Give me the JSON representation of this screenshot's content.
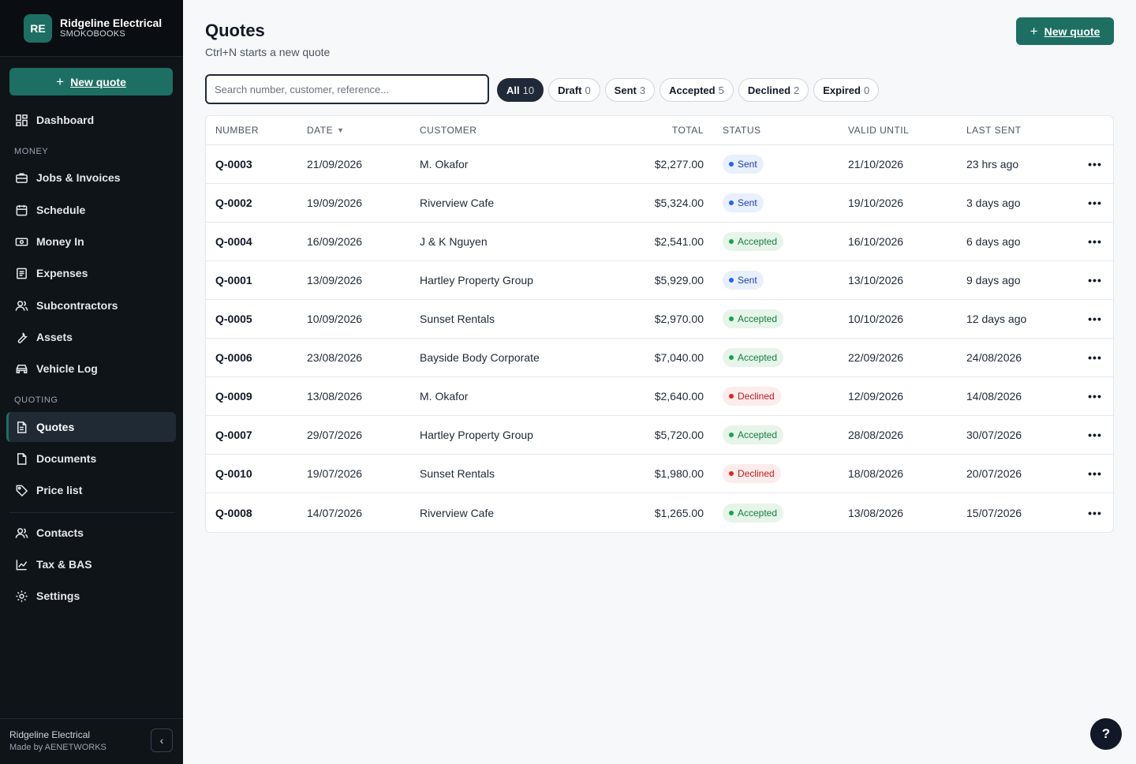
{
  "brand": {
    "initials": "RE",
    "name": "Ridgeline Electrical",
    "sub": "SMOKOBOOKS"
  },
  "sidebar": {
    "new_quote": "New quote",
    "dashboard": "Dashboard",
    "section_money": "MONEY",
    "section_quoting": "QUOTING",
    "items": {
      "jobs": "Jobs & Invoices",
      "schedule": "Schedule",
      "money_in": "Money In",
      "expenses": "Expenses",
      "subcontractors": "Subcontractors",
      "assets": "Assets",
      "vehicle_log": "Vehicle Log",
      "quotes": "Quotes",
      "documents": "Documents",
      "price_list": "Price list",
      "contacts": "Contacts",
      "tax": "Tax & BAS",
      "settings": "Settings"
    },
    "footer_name": "Ridgeline Electrical",
    "footer_made": "Made by AENETWORKS"
  },
  "header": {
    "title": "Quotes",
    "subtitle": "Ctrl+N starts a new quote",
    "new_quote": "New quote"
  },
  "search": {
    "placeholder": "Search number, customer, reference..."
  },
  "filters": [
    {
      "label": "All",
      "count": "10",
      "active": true
    },
    {
      "label": "Draft",
      "count": "0"
    },
    {
      "label": "Sent",
      "count": "3"
    },
    {
      "label": "Accepted",
      "count": "5"
    },
    {
      "label": "Declined",
      "count": "2"
    },
    {
      "label": "Expired",
      "count": "0"
    }
  ],
  "table": {
    "columns": {
      "number": "NUMBER",
      "date": "DATE",
      "customer": "CUSTOMER",
      "total": "TOTAL",
      "status": "STATUS",
      "valid_until": "VALID UNTIL",
      "last_sent": "LAST SENT"
    },
    "rows": [
      {
        "number": "Q-0003",
        "date": "21/09/2026",
        "customer": "M. Okafor",
        "total": "$2,277.00",
        "status": "Sent",
        "valid_until": "21/10/2026",
        "last_sent": "23 hrs ago"
      },
      {
        "number": "Q-0002",
        "date": "19/09/2026",
        "customer": "Riverview Cafe",
        "total": "$5,324.00",
        "status": "Sent",
        "valid_until": "19/10/2026",
        "last_sent": "3 days ago"
      },
      {
        "number": "Q-0004",
        "date": "16/09/2026",
        "customer": "J & K Nguyen",
        "total": "$2,541.00",
        "status": "Accepted",
        "valid_until": "16/10/2026",
        "last_sent": "6 days ago"
      },
      {
        "number": "Q-0001",
        "date": "13/09/2026",
        "customer": "Hartley Property Group",
        "total": "$5,929.00",
        "status": "Sent",
        "valid_until": "13/10/2026",
        "last_sent": "9 days ago"
      },
      {
        "number": "Q-0005",
        "date": "10/09/2026",
        "customer": "Sunset Rentals",
        "total": "$2,970.00",
        "status": "Accepted",
        "valid_until": "10/10/2026",
        "last_sent": "12 days ago"
      },
      {
        "number": "Q-0006",
        "date": "23/08/2026",
        "customer": "Bayside Body Corporate",
        "total": "$7,040.00",
        "status": "Accepted",
        "valid_until": "22/09/2026",
        "last_sent": "24/08/2026"
      },
      {
        "number": "Q-0009",
        "date": "13/08/2026",
        "customer": "M. Okafor",
        "total": "$2,640.00",
        "status": "Declined",
        "valid_until": "12/09/2026",
        "last_sent": "14/08/2026"
      },
      {
        "number": "Q-0007",
        "date": "29/07/2026",
        "customer": "Hartley Property Group",
        "total": "$5,720.00",
        "status": "Accepted",
        "valid_until": "28/08/2026",
        "last_sent": "30/07/2026"
      },
      {
        "number": "Q-0010",
        "date": "19/07/2026",
        "customer": "Sunset Rentals",
        "total": "$1,980.00",
        "status": "Declined",
        "valid_until": "18/08/2026",
        "last_sent": "20/07/2026"
      },
      {
        "number": "Q-0008",
        "date": "14/07/2026",
        "customer": "Riverview Cafe",
        "total": "$1,265.00",
        "status": "Accepted",
        "valid_until": "13/08/2026",
        "last_sent": "15/07/2026"
      }
    ]
  },
  "help": "?"
}
